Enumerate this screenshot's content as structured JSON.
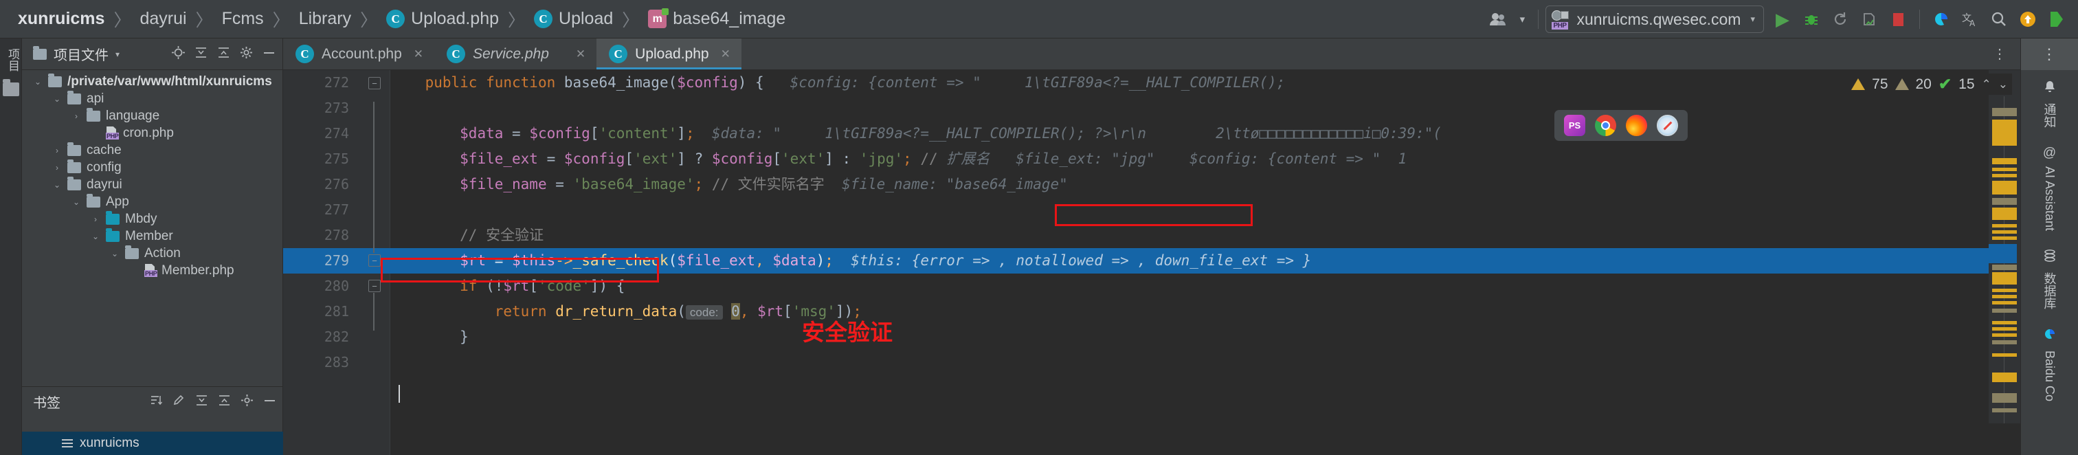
{
  "breadcrumb": {
    "items": [
      {
        "label": "xunruicms",
        "icon": null,
        "bold": true
      },
      {
        "label": "dayrui",
        "icon": null,
        "bold": false
      },
      {
        "label": "Fcms",
        "icon": null,
        "bold": false
      },
      {
        "label": "Library",
        "icon": null,
        "bold": false
      },
      {
        "label": "Upload.php",
        "icon": "class-badge",
        "bold": false
      },
      {
        "label": "Upload",
        "icon": "class-badge",
        "bold": false
      },
      {
        "label": "base64_image",
        "icon": "method-badge",
        "bold": false
      }
    ],
    "separator": "〉"
  },
  "toolbar": {
    "account_icon": "user-group-icon",
    "account_caret": "▾",
    "run_config": {
      "label": "xunruicms.qwesec.com",
      "php_badge": "PHP",
      "caret": "▾"
    },
    "run_button": "▶",
    "debug_button": "debug-icon",
    "rerun_button": "rerun-icon",
    "coverage_button": "coverage-icon",
    "stop_button": "stop-icon",
    "baidu_button": "baidu-icon",
    "translate_button": "文",
    "search_button": "⚲",
    "updates_button": "↑",
    "extra_button": "extra-icon"
  },
  "left_stripe": {
    "project_label": "项目",
    "folder_icon": "folder-icon"
  },
  "project_panel": {
    "title": "项目文件",
    "caret": "▾",
    "tools": [
      "locate-icon",
      "collapse-icon",
      "expand-icon",
      "settings-icon",
      "minimize-icon"
    ],
    "tree": [
      {
        "label": "/private/var/www/html/xunruicms",
        "depth": 0,
        "arrow": "⌄",
        "icon": "folder",
        "bold": true
      },
      {
        "label": "api",
        "depth": 1,
        "arrow": "⌄",
        "icon": "folder",
        "bold": false
      },
      {
        "label": "language",
        "depth": 2,
        "arrow": "›",
        "icon": "folder",
        "bold": false
      },
      {
        "label": "cron.php",
        "depth": 3,
        "arrow": "",
        "icon": "php",
        "bold": false
      },
      {
        "label": "cache",
        "depth": 1,
        "arrow": "›",
        "icon": "folder",
        "bold": false
      },
      {
        "label": "config",
        "depth": 1,
        "arrow": "›",
        "icon": "folder",
        "bold": false
      },
      {
        "label": "dayrui",
        "depth": 1,
        "arrow": "⌄",
        "icon": "folder",
        "bold": false
      },
      {
        "label": "App",
        "depth": 2,
        "arrow": "⌄",
        "icon": "folder",
        "bold": false
      },
      {
        "label": "Mbdy",
        "depth": 3,
        "arrow": "›",
        "icon": "folder-teal",
        "bold": false
      },
      {
        "label": "Member",
        "depth": 3,
        "arrow": "⌄",
        "icon": "folder-teal",
        "bold": false
      },
      {
        "label": "Action",
        "depth": 4,
        "arrow": "⌄",
        "icon": "folder",
        "bold": false
      },
      {
        "label": "Member.php",
        "depth": 5,
        "arrow": "",
        "icon": "php",
        "bold": false
      }
    ],
    "bookmarks": {
      "title": "书签",
      "tools": [
        "sort-icon",
        "edit-icon",
        "collapse-icon",
        "expand-icon",
        "settings-icon",
        "minimize-icon"
      ],
      "selected_item": "xunruicms"
    }
  },
  "editor": {
    "tabs": [
      {
        "label": "Account.php",
        "active": false,
        "italic": false,
        "close": "✕"
      },
      {
        "label": "Service.php",
        "active": false,
        "italic": true,
        "close": "✕"
      },
      {
        "label": "Upload.php",
        "active": true,
        "italic": false,
        "close": "✕"
      }
    ],
    "tabbar_more": "⋮",
    "inspection": {
      "error_count": "75",
      "warning_count": "20",
      "ok_count": "15",
      "up": "⌃",
      "down": "⌄"
    },
    "browsers_popup": [
      "phpstorm-icon",
      "chrome-icon",
      "firefox-icon",
      "safari-icon"
    ],
    "annotations": {
      "ext_note": "扩展名   $file_ext: \"jpg\"",
      "safety_note": "安全验证"
    },
    "lines": [
      {
        "num": "272",
        "selected": false,
        "fold": "minus",
        "tokens": [
          {
            "t": "    ",
            "c": "pl"
          },
          {
            "t": "public function ",
            "c": "kw"
          },
          {
            "t": "base64_image",
            "c": "pl"
          },
          {
            "t": "(",
            "c": "pl"
          },
          {
            "t": "$config",
            "c": "var"
          },
          {
            "t": ") {",
            "c": "pl"
          },
          {
            "t": "   $config: {content => \"",
            "c": "hint"
          },
          {
            "t": "     1\\tGIF89a<?=__HALT_COMPILER();",
            "c": "hint"
          }
        ]
      },
      {
        "num": "273",
        "selected": false,
        "fold": "",
        "tokens": []
      },
      {
        "num": "274",
        "selected": false,
        "fold": "",
        "tokens": [
          {
            "t": "        ",
            "c": "pl"
          },
          {
            "t": "$data ",
            "c": "var"
          },
          {
            "t": "= ",
            "c": "pl"
          },
          {
            "t": "$config",
            "c": "var"
          },
          {
            "t": "[",
            "c": "pl"
          },
          {
            "t": "'content'",
            "c": "str"
          },
          {
            "t": "]",
            "c": "pl"
          },
          {
            "t": ";",
            "c": "kw"
          },
          {
            "t": "  $data: \"     1\\tGIF89a<?=__HALT_COMPILER(); ?>\\r\\n        2\\ttø□□□□□□□□□□□□i□0:39:\"(",
            "c": "hint"
          }
        ]
      },
      {
        "num": "275",
        "selected": false,
        "fold": "",
        "tokens": [
          {
            "t": "        ",
            "c": "pl"
          },
          {
            "t": "$file_ext ",
            "c": "var"
          },
          {
            "t": "= ",
            "c": "pl"
          },
          {
            "t": "$config",
            "c": "var"
          },
          {
            "t": "[",
            "c": "pl"
          },
          {
            "t": "'ext'",
            "c": "str"
          },
          {
            "t": "] ? ",
            "c": "pl"
          },
          {
            "t": "$config",
            "c": "var"
          },
          {
            "t": "[",
            "c": "pl"
          },
          {
            "t": "'ext'",
            "c": "str"
          },
          {
            "t": "] : ",
            "c": "pl"
          },
          {
            "t": "'jpg'",
            "c": "str"
          },
          {
            "t": ";",
            "c": "kw"
          },
          {
            "t": " // ",
            "c": "cmt"
          },
          {
            "t": "扩展名   $file_ext: \"jpg\"",
            "c": "hint"
          },
          {
            "t": "    $config: {content => \"",
            "c": "hint"
          },
          {
            "t": "  1",
            "c": "hint"
          }
        ]
      },
      {
        "num": "276",
        "selected": false,
        "fold": "",
        "tokens": [
          {
            "t": "        ",
            "c": "pl"
          },
          {
            "t": "$file_name ",
            "c": "var"
          },
          {
            "t": "= ",
            "c": "pl"
          },
          {
            "t": "'base64_image'",
            "c": "str"
          },
          {
            "t": ";",
            "c": "kw"
          },
          {
            "t": " // 文件实际名字",
            "c": "cmt"
          },
          {
            "t": "  $file_name: \"base64_image\"",
            "c": "hint"
          }
        ]
      },
      {
        "num": "277",
        "selected": false,
        "fold": "",
        "tokens": []
      },
      {
        "num": "278",
        "selected": false,
        "fold": "",
        "tokens": [
          {
            "t": "        ",
            "c": "pl"
          },
          {
            "t": "// 安全验证",
            "c": "cmt"
          }
        ]
      },
      {
        "num": "279",
        "selected": true,
        "fold": "minus",
        "tokens": [
          {
            "t": "        ",
            "c": "pl"
          },
          {
            "t": "$rt ",
            "c": "var"
          },
          {
            "t": "= ",
            "c": "pl"
          },
          {
            "t": "$this",
            "c": "var"
          },
          {
            "t": "->",
            "c": "kw"
          },
          {
            "t": "_safe_check",
            "c": "fn"
          },
          {
            "t": "(",
            "c": "pl"
          },
          {
            "t": "$file_ext",
            "c": "var"
          },
          {
            "t": ", ",
            "c": "kw"
          },
          {
            "t": "$data",
            "c": "var"
          },
          {
            "t": ")",
            "c": "pl"
          },
          {
            "t": ";",
            "c": "kw"
          },
          {
            "t": "  $this: {error => , notallowed => , down_file_ext => }",
            "c": "hint"
          }
        ]
      },
      {
        "num": "280",
        "selected": false,
        "fold": "minus",
        "tokens": [
          {
            "t": "        ",
            "c": "pl"
          },
          {
            "t": "if ",
            "c": "kw"
          },
          {
            "t": "(!",
            "c": "pl"
          },
          {
            "t": "$rt",
            "c": "var"
          },
          {
            "t": "[",
            "c": "pl"
          },
          {
            "t": "'code'",
            "c": "str"
          },
          {
            "t": "]) {",
            "c": "pl"
          }
        ]
      },
      {
        "num": "281",
        "selected": false,
        "fold": "",
        "tokens": [
          {
            "t": "            ",
            "c": "pl"
          },
          {
            "t": "return ",
            "c": "kw"
          },
          {
            "t": "dr_return_data",
            "c": "fn"
          },
          {
            "t": "(",
            "c": "pl"
          },
          {
            "t": "code:",
            "c": "paramhint"
          },
          {
            "t": " ",
            "c": "pl"
          },
          {
            "t": "0",
            "c": "numhl"
          },
          {
            "t": ", ",
            "c": "kw"
          },
          {
            "t": "$rt",
            "c": "var"
          },
          {
            "t": "[",
            "c": "pl"
          },
          {
            "t": "'msg'",
            "c": "str"
          },
          {
            "t": "])",
            "c": "pl"
          },
          {
            "t": ";",
            "c": "kw"
          }
        ]
      },
      {
        "num": "282",
        "selected": false,
        "fold": "",
        "tokens": [
          {
            "t": "        ",
            "c": "pl"
          },
          {
            "t": "}",
            "c": "pl"
          }
        ]
      },
      {
        "num": "283",
        "selected": false,
        "fold": "",
        "tokens": []
      }
    ]
  },
  "right_stripe": {
    "more": "⋮",
    "items": [
      {
        "label": "通知",
        "glyph": "🔔",
        "kind": "bell"
      },
      {
        "label": "AI Assistant",
        "glyph": "@",
        "kind": "at"
      },
      {
        "label": "数据库",
        "glyph": "☷",
        "kind": "db"
      },
      {
        "label": "Baidu Co",
        "glyph": "",
        "kind": "baidu"
      }
    ]
  },
  "colors": {
    "accent": "#3592c4",
    "selection": "#1565a7",
    "annotation_red": "#f21b1b",
    "editor_bg": "#2b2b2b",
    "panel_bg": "#3c3f41"
  }
}
